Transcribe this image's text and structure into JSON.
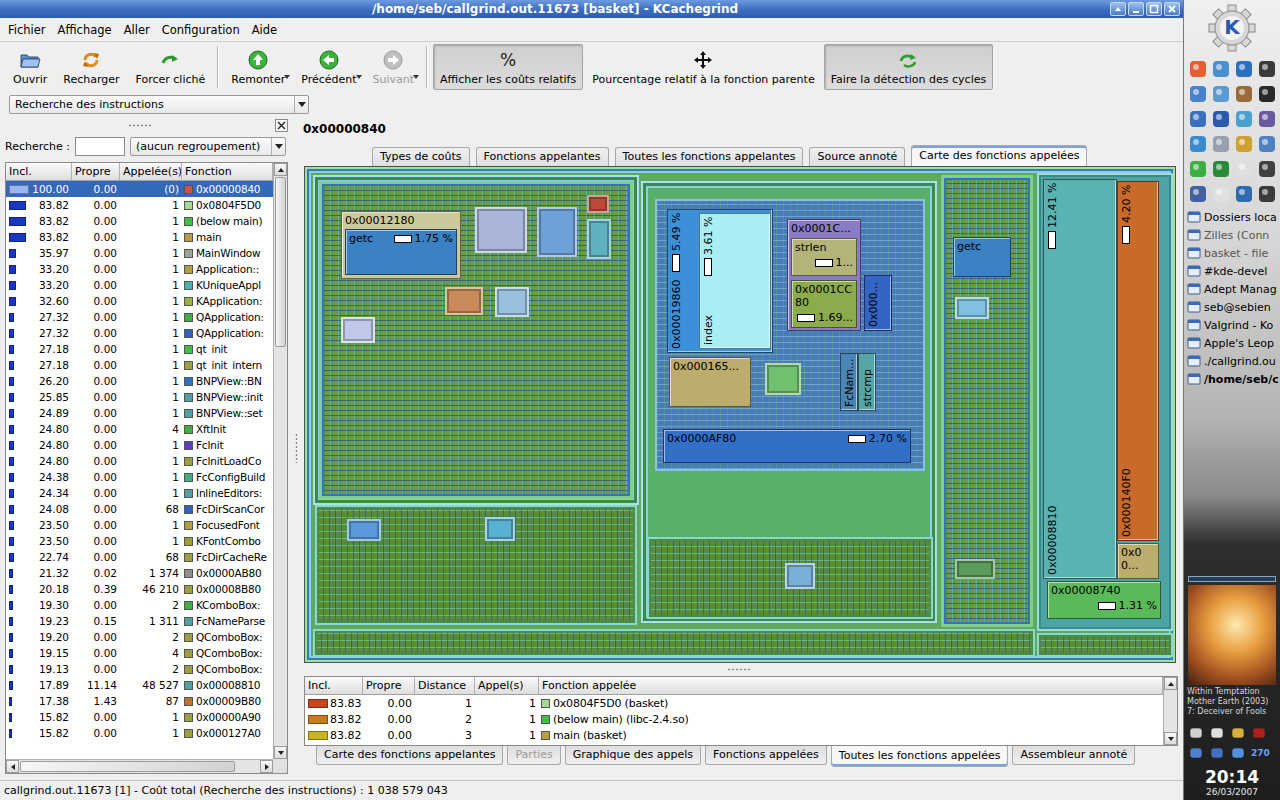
{
  "window": {
    "title": "/home/seb/callgrind.out.11673 [basket] - KCachegrind"
  },
  "menu": [
    "Fichier",
    "Affichage",
    "Aller",
    "Configuration",
    "Aide"
  ],
  "toolbar": [
    {
      "label": "Ouvrir",
      "kind": "open",
      "disabled": false,
      "pressed": false,
      "menu": false,
      "separator_before": false
    },
    {
      "label": "Recharger",
      "kind": "reload",
      "disabled": false,
      "pressed": false,
      "menu": false,
      "separator_before": false
    },
    {
      "label": "Forcer cliché",
      "kind": "dump",
      "disabled": false,
      "pressed": false,
      "menu": false,
      "separator_before": false
    },
    {
      "label": "Remonter",
      "kind": "up",
      "disabled": false,
      "pressed": false,
      "menu": true,
      "separator_before": true
    },
    {
      "label": "Précédent",
      "kind": "back",
      "disabled": false,
      "pressed": false,
      "menu": true,
      "separator_before": false
    },
    {
      "label": "Suivant",
      "kind": "forward",
      "disabled": true,
      "pressed": false,
      "menu": true,
      "separator_before": false
    },
    {
      "label": "Afficher les coûts relatifs",
      "kind": "percent",
      "glyph": "%",
      "disabled": false,
      "pressed": true,
      "menu": false,
      "separator_before": true
    },
    {
      "label": "Pourcentage relatif à la fonction parente",
      "kind": "move",
      "disabled": false,
      "pressed": false,
      "menu": false,
      "separator_before": false
    },
    {
      "label": "Faire la détection des cycles",
      "kind": "cycle",
      "disabled": false,
      "pressed": true,
      "menu": false,
      "separator_before": false
    }
  ],
  "event_type": "Recherche des instructions",
  "sidebar": {
    "search_label": "Recherche :",
    "search_value": "",
    "grouping": "(aucun regroupement)",
    "scroll_level": 0.3,
    "hscroll_level": 0.9,
    "columns": [
      "Incl.",
      "Propre",
      "Appelée(s)",
      "Fonction"
    ],
    "rows": [
      {
        "incl": "100.00",
        "self": "0.00",
        "calls": "(0)",
        "name": "0x00000840",
        "color": "#d05050",
        "level": 1.0,
        "selected": true
      },
      {
        "incl": "83.82",
        "self": "0.00",
        "calls": "1",
        "name": "0x0804F5D0",
        "color": "#a8d890",
        "level": 0.8382,
        "selected": false
      },
      {
        "incl": "83.82",
        "self": "0.00",
        "calls": "1",
        "name": "(below main)",
        "color": "#40c040",
        "level": 0.8382,
        "selected": false
      },
      {
        "incl": "83.82",
        "self": "0.00",
        "calls": "1",
        "name": "main",
        "color": "#b8a040",
        "level": 0.8382,
        "selected": false
      },
      {
        "incl": "35.97",
        "self": "0.00",
        "calls": "1",
        "name": "MainWindow",
        "color": "#98a898",
        "level": 0.3597,
        "selected": false
      },
      {
        "incl": "33.20",
        "self": "0.00",
        "calls": "1",
        "name": "Application::",
        "color": "#b0a040",
        "level": 0.332,
        "selected": false
      },
      {
        "incl": "33.20",
        "self": "0.00",
        "calls": "1",
        "name": "KUniqueAppl",
        "color": "#50b0b0",
        "level": 0.332,
        "selected": false
      },
      {
        "incl": "32.60",
        "self": "0.00",
        "calls": "1",
        "name": "KApplication:",
        "color": "#a0b040",
        "level": 0.326,
        "selected": false
      },
      {
        "incl": "27.32",
        "self": "0.00",
        "calls": "1",
        "name": "QApplication:",
        "color": "#40b040",
        "level": 0.2732,
        "selected": false
      },
      {
        "incl": "27.32",
        "self": "0.00",
        "calls": "1",
        "name": "QApplication:",
        "color": "#3060c0",
        "level": 0.2732,
        "selected": false
      },
      {
        "incl": "27.18",
        "self": "0.00",
        "calls": "1",
        "name": "qt_init",
        "color": "#40c040",
        "level": 0.2718,
        "selected": false
      },
      {
        "incl": "27.18",
        "self": "0.00",
        "calls": "1",
        "name": "qt_init_intern",
        "color": "#a0a040",
        "level": 0.2718,
        "selected": false
      },
      {
        "incl": "26.20",
        "self": "0.00",
        "calls": "1",
        "name": "BNPView::BN",
        "color": "#3070c0",
        "level": 0.262,
        "selected": false
      },
      {
        "incl": "25.85",
        "self": "0.00",
        "calls": "1",
        "name": "BNPView::init",
        "color": "#50a0a0",
        "level": 0.2585,
        "selected": false
      },
      {
        "incl": "24.89",
        "self": "0.00",
        "calls": "1",
        "name": "BNPView::set",
        "color": "#50a0a0",
        "level": 0.2489,
        "selected": false
      },
      {
        "incl": "24.80",
        "self": "0.00",
        "calls": "4",
        "name": "XftInit",
        "color": "#40b040",
        "level": 0.248,
        "selected": false
      },
      {
        "incl": "24.80",
        "self": "0.00",
        "calls": "1",
        "name": "FcInit",
        "color": "#6040c0",
        "level": 0.248,
        "selected": false
      },
      {
        "incl": "24.80",
        "self": "0.00",
        "calls": "1",
        "name": "FcInitLoadCo",
        "color": "#a0a040",
        "level": 0.248,
        "selected": false
      },
      {
        "incl": "24.38",
        "self": "0.00",
        "calls": "1",
        "name": "FcConfigBuild",
        "color": "#40b080",
        "level": 0.2438,
        "selected": false
      },
      {
        "incl": "24.34",
        "self": "0.00",
        "calls": "1",
        "name": "InlineEditors:",
        "color": "#50a0a0",
        "level": 0.2434,
        "selected": false
      },
      {
        "incl": "24.08",
        "self": "0.00",
        "calls": "68",
        "name": "FcDirScanCor",
        "color": "#3060c0",
        "level": 0.2408,
        "selected": false
      },
      {
        "incl": "23.50",
        "self": "0.00",
        "calls": "1",
        "name": "FocusedFont",
        "color": "#b0a040",
        "level": 0.235,
        "selected": false
      },
      {
        "incl": "23.50",
        "self": "0.00",
        "calls": "1",
        "name": "KFontCombo",
        "color": "#a0a030",
        "level": 0.235,
        "selected": false
      },
      {
        "incl": "22.74",
        "self": "0.00",
        "calls": "68",
        "name": "FcDirCacheRe",
        "color": "#a0a040",
        "level": 0.2274,
        "selected": false
      },
      {
        "incl": "21.32",
        "self": "0.02",
        "calls": "1 374",
        "name": "0x0000AB80",
        "color": "#909090",
        "level": 0.2132,
        "selected": false
      },
      {
        "incl": "20.18",
        "self": "0.39",
        "calls": "46 210",
        "name": "0x00008B80",
        "color": "#a0a040",
        "level": 0.2018,
        "selected": false
      },
      {
        "incl": "19.30",
        "self": "0.00",
        "calls": "2",
        "name": "KComboBox:",
        "color": "#40b040",
        "level": 0.193,
        "selected": false
      },
      {
        "incl": "19.23",
        "self": "0.15",
        "calls": "1 311",
        "name": "FcNameParse",
        "color": "#50a0a0",
        "level": 0.1923,
        "selected": false
      },
      {
        "incl": "19.20",
        "self": "0.00",
        "calls": "2",
        "name": "QComboBox:",
        "color": "#a0a040",
        "level": 0.192,
        "selected": false
      },
      {
        "incl": "19.15",
        "self": "0.00",
        "calls": "4",
        "name": "QComboBox:",
        "color": "#a0a040",
        "level": 0.1915,
        "selected": false
      },
      {
        "incl": "19.13",
        "self": "0.00",
        "calls": "2",
        "name": "QComboBox:",
        "color": "#a0a040",
        "level": 0.1913,
        "selected": false
      },
      {
        "incl": "17.89",
        "self": "11.14",
        "calls": "48 527",
        "name": "0x00008810",
        "color": "#50a0a0",
        "level": 0.1789,
        "selected": false
      },
      {
        "incl": "17.38",
        "self": "1.43",
        "calls": "87",
        "name": "0x00009B80",
        "color": "#c07030",
        "level": 0.1738,
        "selected": false
      },
      {
        "incl": "15.82",
        "self": "0.00",
        "calls": "1",
        "name": "0x00000A90",
        "color": "#a0a040",
        "level": 0.1582,
        "selected": false
      },
      {
        "incl": "15.82",
        "self": "0.00",
        "calls": "1",
        "name": "0x000127A0",
        "color": "#a0a040",
        "level": 0.1582,
        "selected": false
      }
    ]
  },
  "detail": {
    "function": "0x00000840",
    "tabs": [
      {
        "label": "Types de coûts",
        "selected": false
      },
      {
        "label": "Fonctions appelantes",
        "selected": false
      },
      {
        "label": "Toutes les fonctions appelantes",
        "selected": false
      },
      {
        "label": "Source annoté",
        "selected": false
      },
      {
        "label": "Carte des fonctions appelées",
        "selected": true
      }
    ],
    "treemap": [
      {
        "name": "0x00012180",
        "kind": "box",
        "color": "#cdc89c"
      },
      {
        "name": "getc",
        "kind": "box",
        "color": "#3a82c4",
        "percent": "1.75 %"
      },
      {
        "name": "0x00019860",
        "kind": "vertical",
        "color": "#3d8fd8",
        "percent": "5.49 %"
      },
      {
        "name": "index",
        "kind": "vertical",
        "color": "#a8eef4",
        "percent": "3.61 %"
      },
      {
        "name": "0x0001C...",
        "kind": "box",
        "color": "#8a7cc4"
      },
      {
        "name": "strlen",
        "kind": "box",
        "color": "#b4b478",
        "percent": "1..."
      },
      {
        "name": "0x0001CC80",
        "kind": "box",
        "color": "#8cac4c",
        "percent": "1.69..."
      },
      {
        "name": "0x000...",
        "kind": "vertical",
        "color": "#3464c4"
      },
      {
        "name": "0x000165...",
        "kind": "box",
        "color": "#bcad6c"
      },
      {
        "name": "FcNam...",
        "kind": "vertical",
        "color": "#4a86b4"
      },
      {
        "name": "strcmp",
        "kind": "vertical",
        "color": "#56a6a6"
      },
      {
        "name": "0x0000AF80",
        "kind": "box",
        "color": "#3270c8",
        "percent": "2.70 %"
      },
      {
        "name": "getc",
        "kind": "box",
        "color": "#3a82c4"
      },
      {
        "name": "0x00008810",
        "kind": "vertical",
        "color": "#5ab2b2",
        "percent": "12.41 %"
      },
      {
        "name": "0x000140F0",
        "kind": "vertical",
        "color": "#c96a2a",
        "percent": "4.20 %"
      },
      {
        "name": "0x00...",
        "kind": "box",
        "color": "#bcad6c"
      },
      {
        "name": "0x00008740",
        "kind": "box",
        "color": "#5aba5a",
        "percent": "1.31 %"
      }
    ],
    "callees": {
      "columns": [
        "Incl.",
        "Propre",
        "Distance",
        "Appel(s)",
        "Fonction appelée"
      ],
      "rows": [
        {
          "incl": "83.83",
          "self": "0.00",
          "distance": "1",
          "calls": "1",
          "name": "0x0804F5D0 (basket)",
          "bar_color": "#c8461e",
          "color": "#a8d890",
          "level": 0.8383
        },
        {
          "incl": "83.82",
          "self": "0.00",
          "distance": "2",
          "calls": "1",
          "name": "(below main) (libc-2.4.so)",
          "bar_color": "#c87a1e",
          "color": "#40c040",
          "level": 0.8382
        },
        {
          "incl": "83.82",
          "self": "0.00",
          "distance": "3",
          "calls": "1",
          "name": "main (basket)",
          "bar_color": "#c8b41e",
          "color": "#b8a040",
          "level": 0.8382
        }
      ]
    },
    "bottom_tabs": [
      {
        "label": "Carte des fonctions appelantes",
        "selected": false,
        "disabled": false
      },
      {
        "label": "Parties",
        "selected": false,
        "disabled": true
      },
      {
        "label": "Graphique des appels",
        "selected": false,
        "disabled": false
      },
      {
        "label": "Fonctions appelées",
        "selected": false,
        "disabled": false
      },
      {
        "label": "Toutes les fonctions appelées",
        "selected": true,
        "disabled": false
      },
      {
        "label": "Assembleur annoté",
        "selected": false,
        "disabled": false
      }
    ]
  },
  "status_bar": "callgrind.out.11673 [1] - Coût total (Recherche des instructions) : 1 038 579 043",
  "panel": {
    "logo": "K",
    "tasks": [
      {
        "label": "Dossiers loca",
        "active": false,
        "dimmed": false
      },
      {
        "label": "Zilles (Conn",
        "active": false,
        "dimmed": true
      },
      {
        "label": "basket - file",
        "active": false,
        "dimmed": true
      },
      {
        "label": "#kde-devel",
        "active": false,
        "dimmed": false
      },
      {
        "label": "Adept Manag",
        "active": false,
        "dimmed": false
      },
      {
        "label": "seb@sebien",
        "active": false,
        "dimmed": false
      },
      {
        "label": "Valgrind - Ko",
        "active": false,
        "dimmed": false
      },
      {
        "label": "Apple's Leop",
        "active": false,
        "dimmed": false
      },
      {
        "label": "./callgrind.ou",
        "active": false,
        "dimmed": false
      },
      {
        "label": "/home/seb/c",
        "active": true,
        "dimmed": false
      }
    ],
    "now_playing": [
      "Within Temptation",
      "Mother Earth (2003)",
      "7: Deceiver of Fools"
    ],
    "tray_count": "270",
    "clock": "20:14",
    "date": "26/03/2007"
  }
}
